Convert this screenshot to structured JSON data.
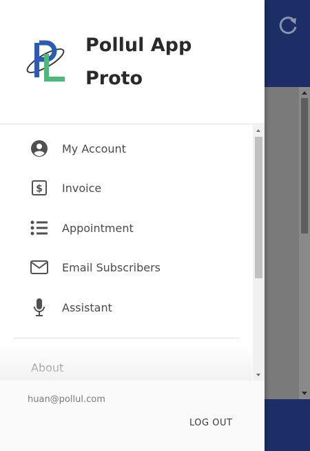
{
  "app": {
    "title": "Pollul App Proto",
    "accent_color": "#1b2f66",
    "logo_icon": "pollul-logo-icon"
  },
  "header_bar": {
    "refresh_icon": "refresh-icon"
  },
  "menu": {
    "items": [
      {
        "label": "My Account",
        "icon": "account-circle-icon"
      },
      {
        "label": "Invoice",
        "icon": "dollar-receipt-icon"
      },
      {
        "label": "Appointment",
        "icon": "list-icon"
      },
      {
        "label": "Email Subscribers",
        "icon": "envelope-icon"
      },
      {
        "label": "Assistant",
        "icon": "microphone-icon"
      }
    ],
    "about_label": "About"
  },
  "footer": {
    "email": "huan@pollul.com",
    "logout_label": "LOG OUT"
  }
}
